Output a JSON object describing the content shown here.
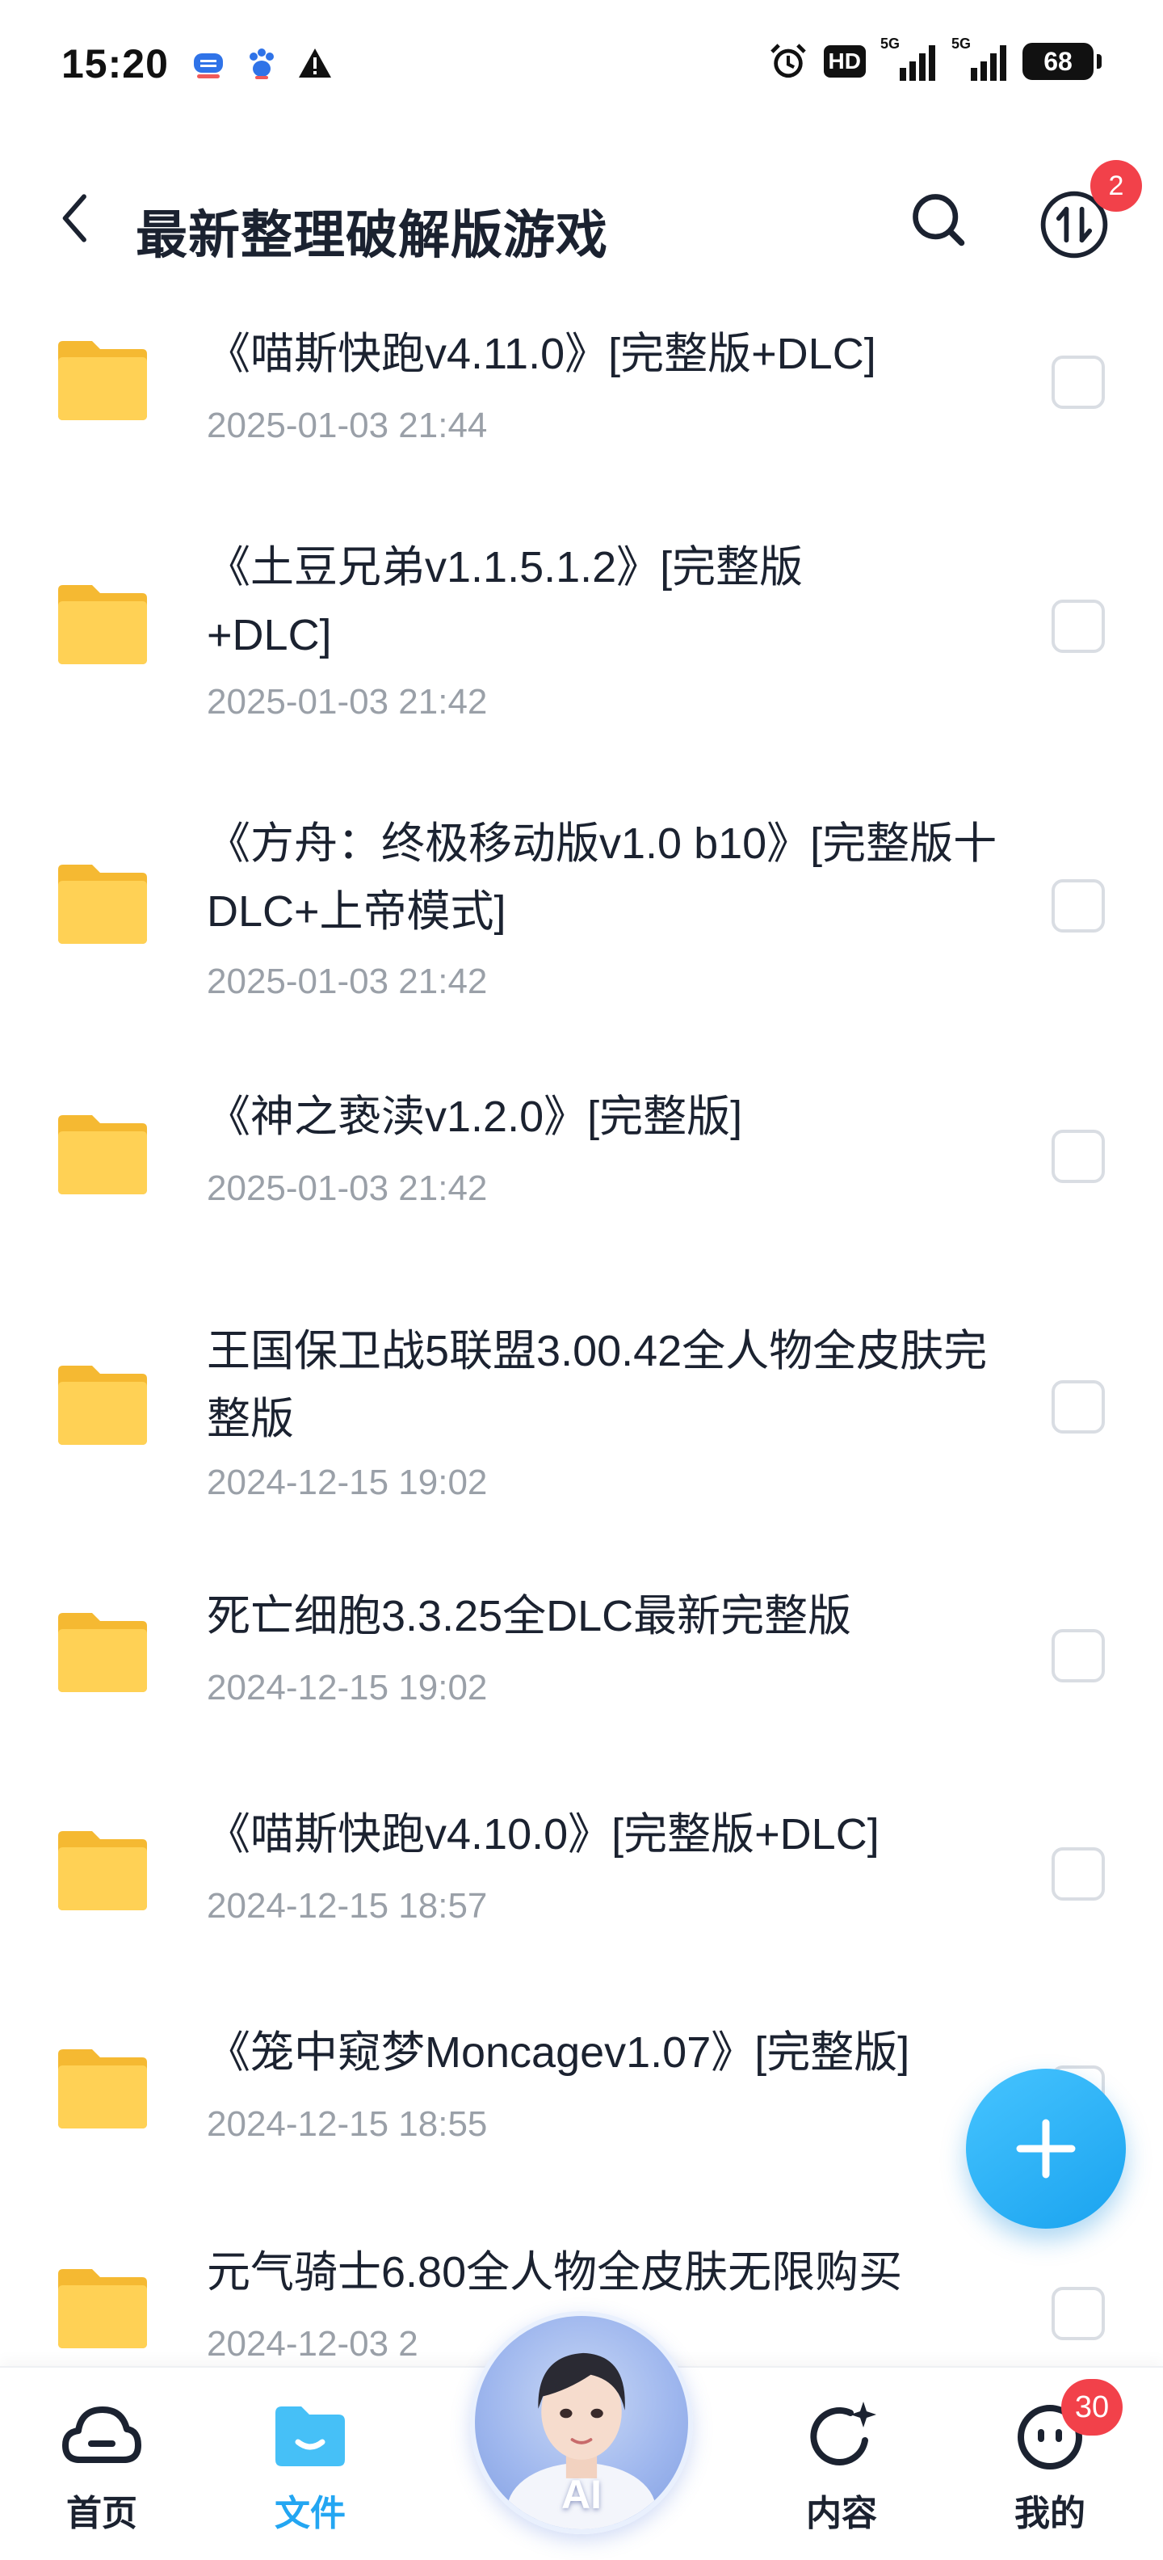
{
  "status_bar": {
    "time": "15:20",
    "hd_label": "HD",
    "network_1": "5G",
    "network_2": "5G",
    "battery": "68"
  },
  "header": {
    "title": "最新整理破解版游戏",
    "transfer_badge": "2"
  },
  "files": [
    {
      "name": "《喵斯快跑v4.11.0》[完整版+DLC]",
      "date": "2025-01-03 21:44"
    },
    {
      "name": "《土豆兄弟v1.1.5.1.2》[完整版+DLC]",
      "date": "2025-01-03 21:42"
    },
    {
      "name": "《方舟：终极移动版v1.0 b10》[完整版十DLC+上帝模式]",
      "date": "2025-01-03 21:42"
    },
    {
      "name": "《神之亵渎v1.2.0》[完整版]",
      "date": "2025-01-03 21:42"
    },
    {
      "name": "王国保卫战5联盟3.00.42全人物全皮肤完整版",
      "date": "2024-12-15 19:02"
    },
    {
      "name": "死亡细胞3.3.25全DLC最新完整版",
      "date": "2024-12-15 19:02"
    },
    {
      "name": "《喵斯快跑v4.10.0》[完整版+DLC]",
      "date": "2024-12-15 18:57"
    },
    {
      "name": "《笼中窥梦Moncagev1.07》[完整版]",
      "date": "2024-12-15 18:55"
    },
    {
      "name": "元气骑士6.80全人物全皮肤无限购买",
      "date": "2024-12-03 2"
    }
  ],
  "bottom_nav": {
    "home": "首页",
    "files": "文件",
    "ai": "AI",
    "content": "内容",
    "mine": "我的",
    "mine_badge": "30"
  },
  "colors": {
    "accent": "#23a6f2",
    "folder": "#ffd155",
    "badge": "#f2414a",
    "text": "#1b2230",
    "muted": "#9aa0a8"
  }
}
